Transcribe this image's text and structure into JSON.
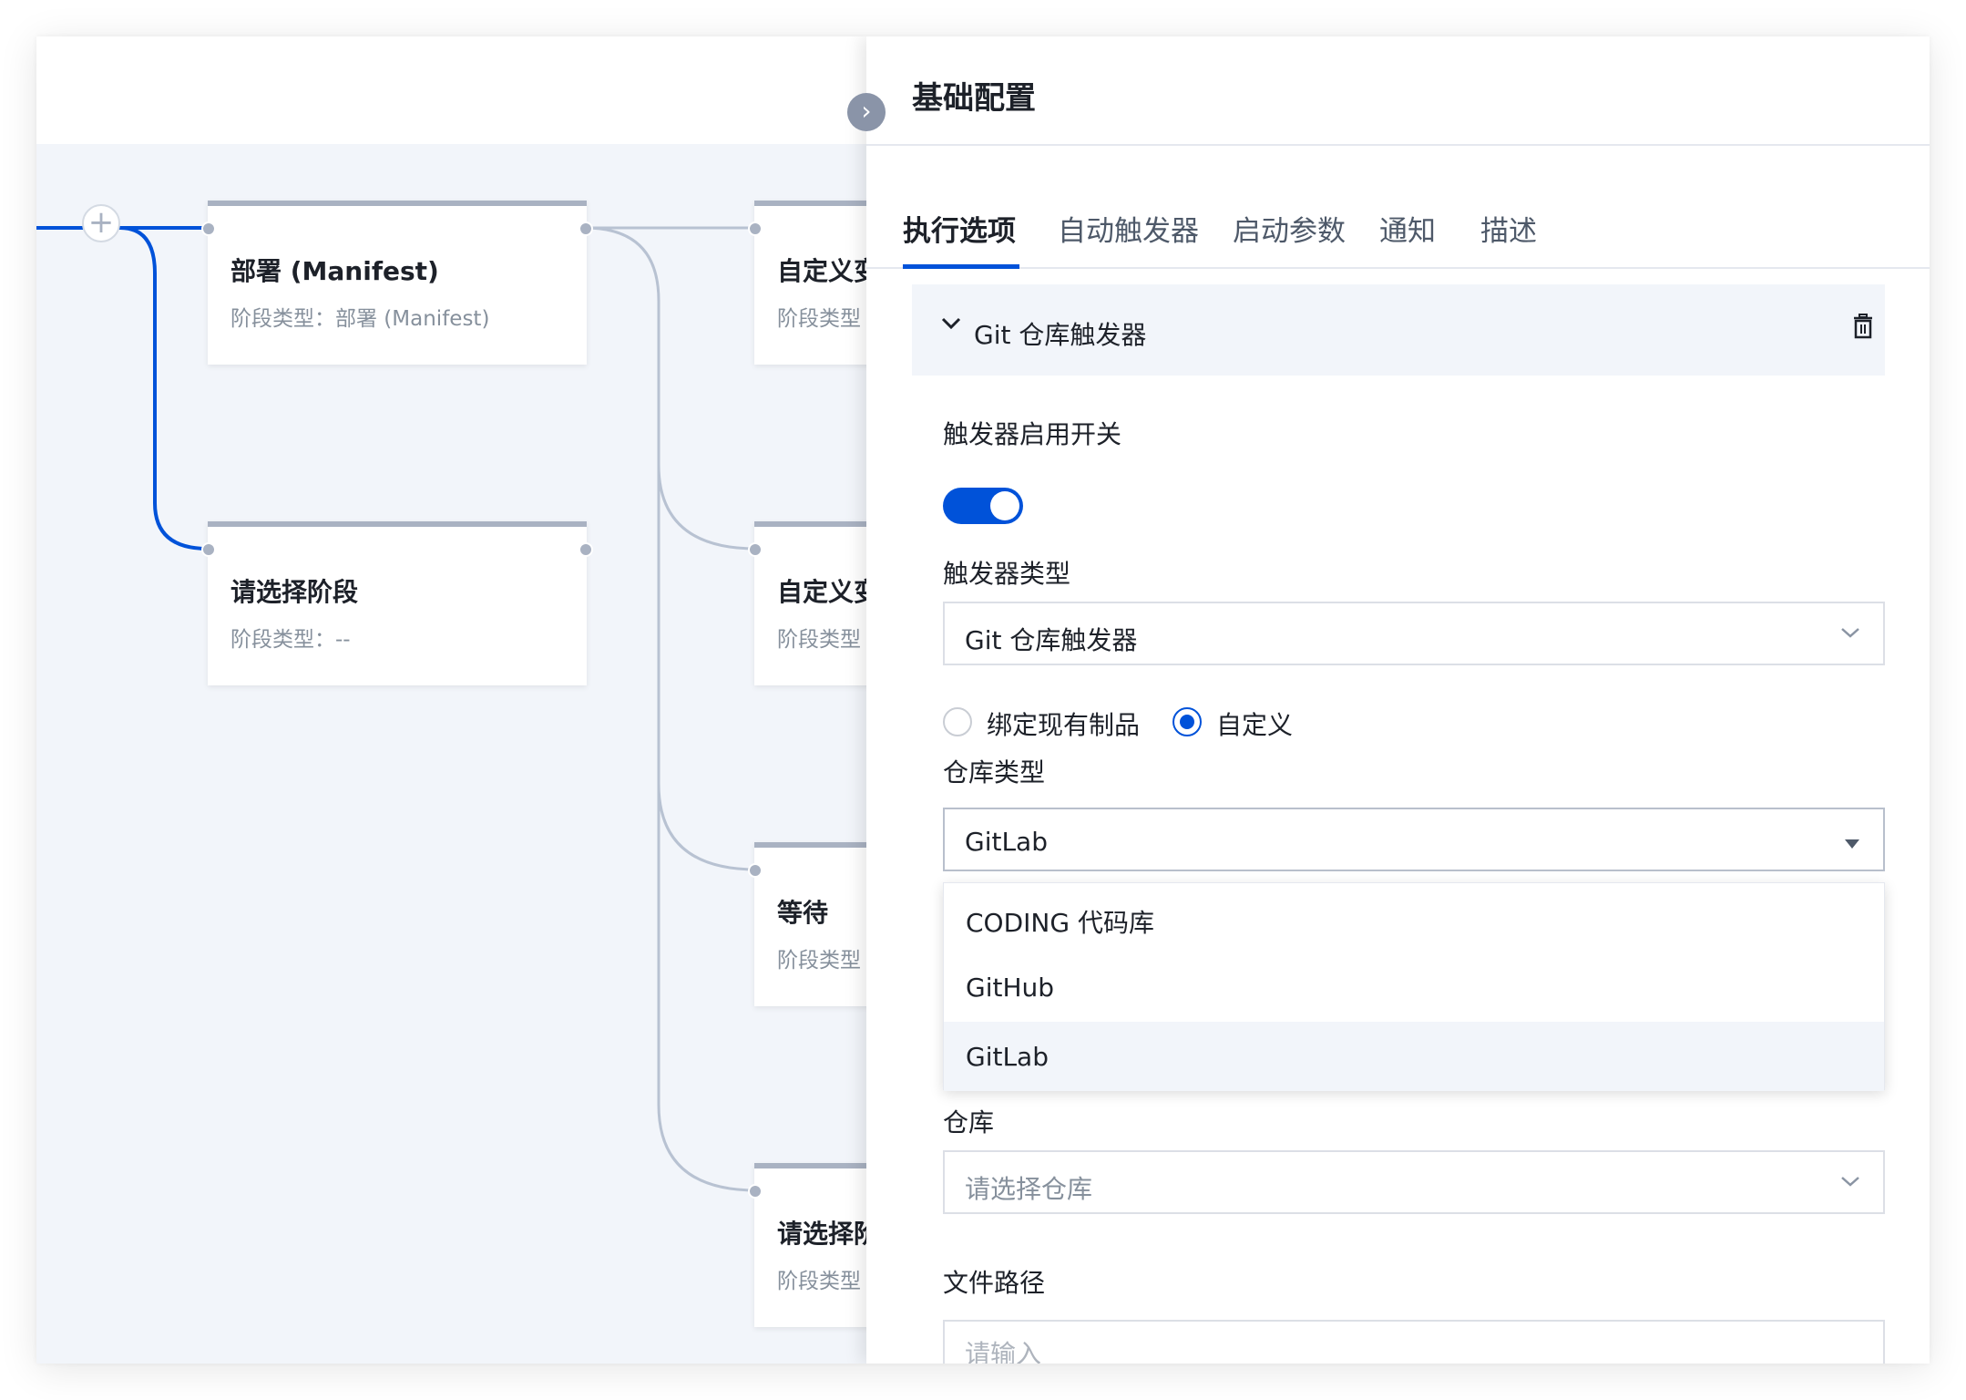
{
  "panel": {
    "title": "基础配置",
    "tabs": [
      {
        "label": "执行选项",
        "active": true
      },
      {
        "label": "自动触发器",
        "active": false
      },
      {
        "label": "启动参数",
        "active": false
      },
      {
        "label": "通知",
        "active": false
      },
      {
        "label": "描述",
        "active": false
      }
    ],
    "section": {
      "title": "Git 仓库触发器"
    },
    "trigger_switch": {
      "label": "触发器启用开关",
      "enabled": true
    },
    "trigger_type": {
      "label": "触发器类型",
      "value": "Git 仓库触发器"
    },
    "source_mode": {
      "options": [
        {
          "label": "绑定现有制品",
          "checked": false
        },
        {
          "label": "自定义",
          "checked": true
        }
      ]
    },
    "repo_type": {
      "label": "仓库类型",
      "value": "GitLab",
      "options": [
        "CODING 代码库",
        "GitHub",
        "GitLab"
      ],
      "selected": "GitLab"
    },
    "repo": {
      "label": "仓库",
      "placeholder": "请选择仓库"
    },
    "file_path": {
      "label": "文件路径",
      "placeholder": "请输入"
    }
  },
  "pipeline": {
    "stages": [
      {
        "title": "部署 (Manifest)",
        "subtitle": "阶段类型：部署 (Manifest)"
      },
      {
        "title": "请选择阶段",
        "subtitle": "阶段类型：--"
      },
      {
        "title": "自定义变",
        "subtitle": "阶段类型"
      },
      {
        "title": "自定义变",
        "subtitle": "阶段类型"
      },
      {
        "title": "等待",
        "subtitle": "阶段类型"
      },
      {
        "title": "请选择阶",
        "subtitle": "阶段类型"
      }
    ]
  },
  "colors": {
    "primary": "#0052d9",
    "canvas_bg": "#f2f5fa",
    "connector": "#b8c2d2",
    "card_top_border": "#a9b2c2"
  }
}
